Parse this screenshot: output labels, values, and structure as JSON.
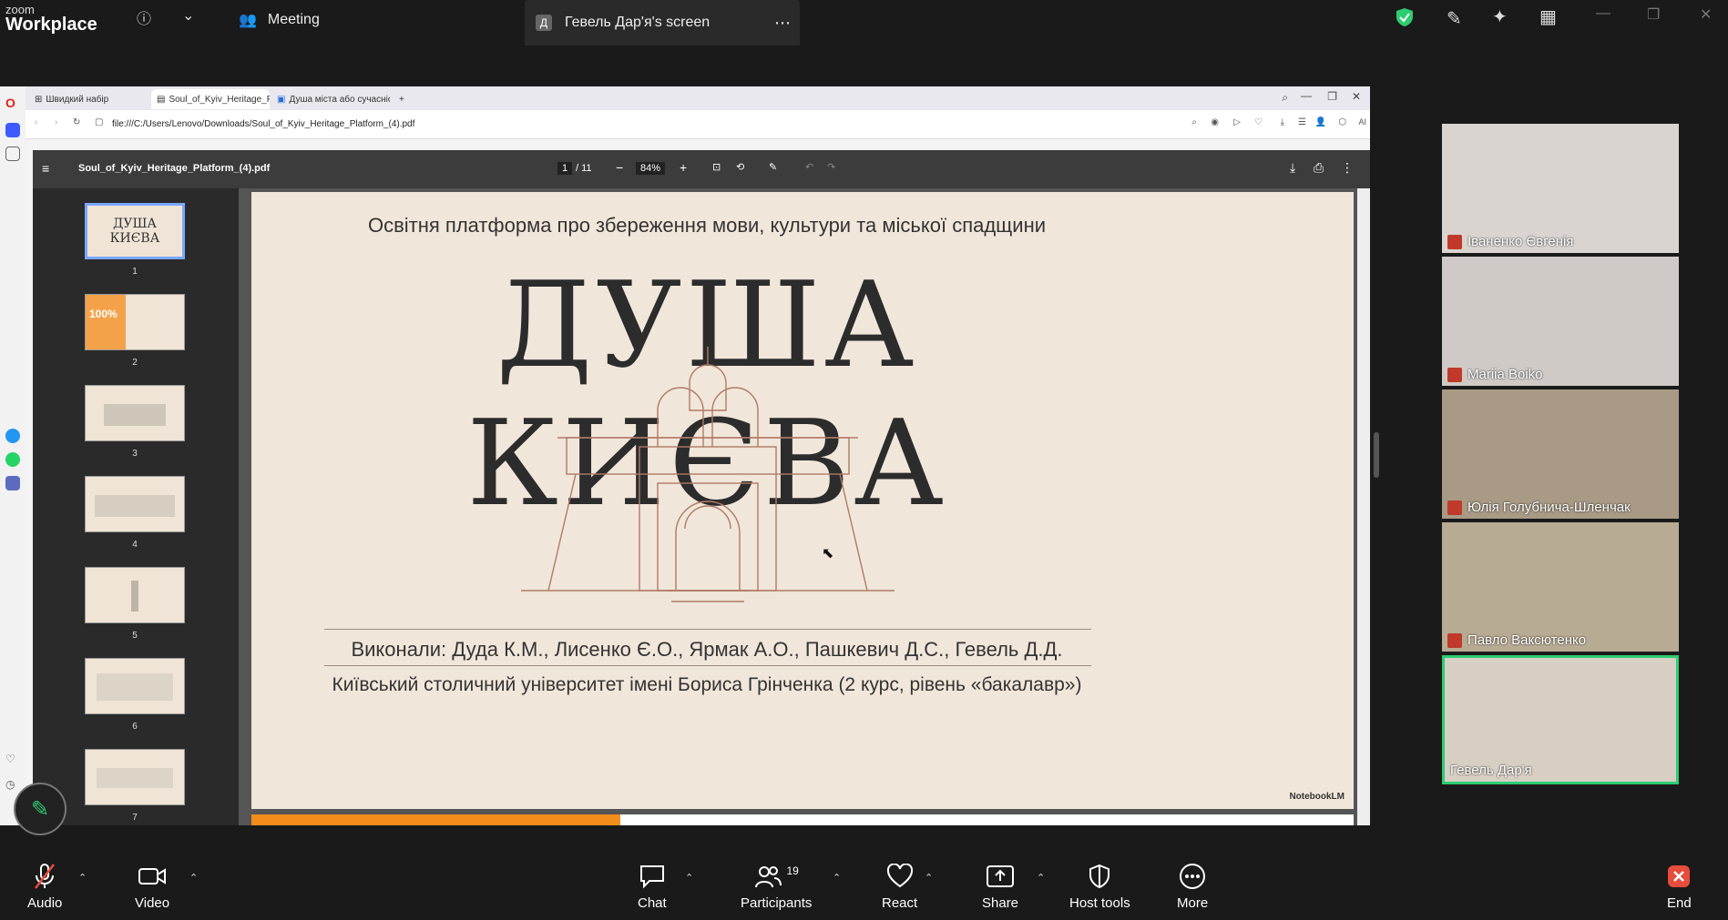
{
  "app": {
    "logo_small": "zoom",
    "logo_big": "Workplace"
  },
  "topbar": {
    "meeting_label": "Meeting",
    "screen_badge": "Д",
    "screen_label": "Гевель Дар'я's screen"
  },
  "browser": {
    "tabs": [
      {
        "label": "Швидкий набір"
      },
      {
        "label": "Soul_of_Kyiv_Heritage_Pla"
      },
      {
        "label": "Душа міста або сучасніс"
      }
    ],
    "url": "file:///C:/Users/Lenovo/Downloads/Soul_of_Kyiv_Heritage_Platform_(4).pdf",
    "ai_label": "AI"
  },
  "pdf": {
    "filename": "Soul_of_Kyiv_Heritage_Platform_(4).pdf",
    "page_current": "1",
    "page_total": "/ 11",
    "zoom": "84%",
    "thumbnails": [
      {
        "num": "1",
        "title": "ДУША КИЄВА"
      },
      {
        "num": "2",
        "title": "100%"
      },
      {
        "num": "3",
        "title": ""
      },
      {
        "num": "4",
        "title": ""
      },
      {
        "num": "5",
        "title": ""
      },
      {
        "num": "6",
        "title": ""
      },
      {
        "num": "7",
        "title": ""
      }
    ]
  },
  "slide": {
    "subtitle": "Освітня платформа про збереження мови, культури та міської спадщини",
    "title": "ДУША КИЄВА",
    "authors": "Виконали: Дуда К.М., Лисенко Є.О., Ярмак А.О., Пашкевич Д.С., Гевель Д.Д.",
    "university": "Київський столичний університет імені Бориса Грінченка (2 курс, рівень «бакалавр»)",
    "brand": "NotebookLM"
  },
  "participants_tiles": [
    {
      "name": "Іваненко Євгенія",
      "bg": "#d9d4cf"
    },
    {
      "name": "Mariia Boiko",
      "bg": "#cfcac6"
    },
    {
      "name": "Юлія Голубнича-Шленчак",
      "bg": "#a89a85"
    },
    {
      "name": "Павло Ваксютенко",
      "bg": "#b8ab94"
    },
    {
      "name": "Гевель Дар'я",
      "bg": "#d8cfc4"
    }
  ],
  "toolbar": {
    "audio": "Audio",
    "video": "Video",
    "chat": "Chat",
    "participants": "Participants",
    "participants_count": "19",
    "react": "React",
    "share": "Share",
    "host_tools": "Host tools",
    "more": "More",
    "end": "End"
  },
  "colors": {
    "green": "#2ecc71",
    "end_red": "#e74c3c",
    "progress": "#f28c1b"
  }
}
